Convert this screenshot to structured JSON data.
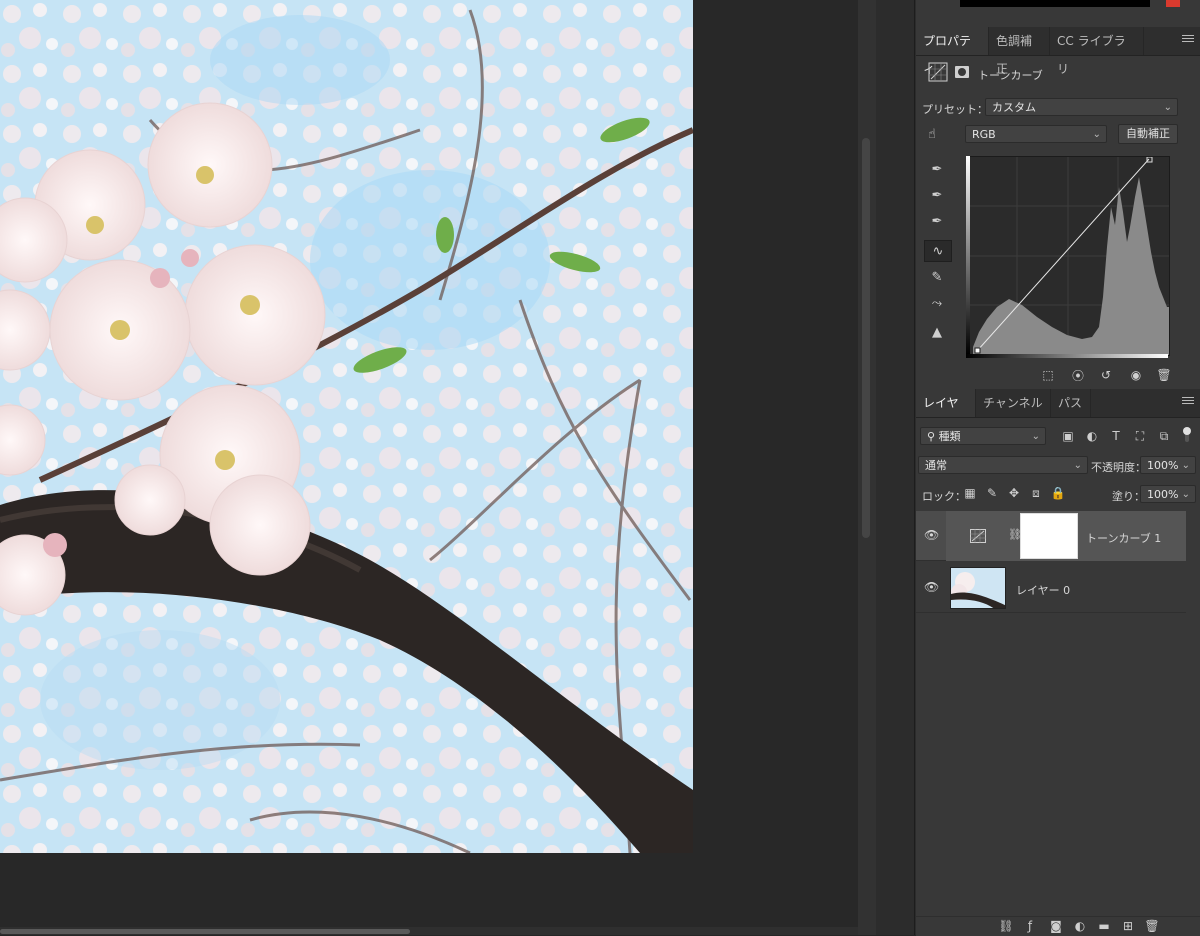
{
  "photo": {
    "description_alt": "cherry blossom photo"
  },
  "properties_panel": {
    "tabs": [
      {
        "label": "プロパティ",
        "active": true
      },
      {
        "label": "色調補正",
        "active": false
      },
      {
        "label": "CC ライブラリ",
        "active": false
      }
    ],
    "adjustment_name": "トーンカーブ",
    "preset_label": "プリセット：",
    "preset_value": "カスタム",
    "channel_value": "RGB",
    "auto_button": "自動補正"
  },
  "layers_panel": {
    "tabs": [
      {
        "label": "レイヤー",
        "active": true
      },
      {
        "label": "チャンネル",
        "active": false
      },
      {
        "label": "パス",
        "active": false
      }
    ],
    "filter_value": "種類",
    "blend_mode": "通常",
    "opacity_label": "不透明度：",
    "opacity_value": "100%",
    "lock_label": "ロック：",
    "fill_label": "塗り：",
    "fill_value": "100%",
    "layers": [
      {
        "name": "トーンカーブ 1",
        "selected": true
      },
      {
        "name": "レイヤー 0",
        "selected": false
      }
    ]
  },
  "colors": {
    "panel_bg": "#383838",
    "canvas_bg": "#282828",
    "accent_red": "#d93a2e"
  }
}
